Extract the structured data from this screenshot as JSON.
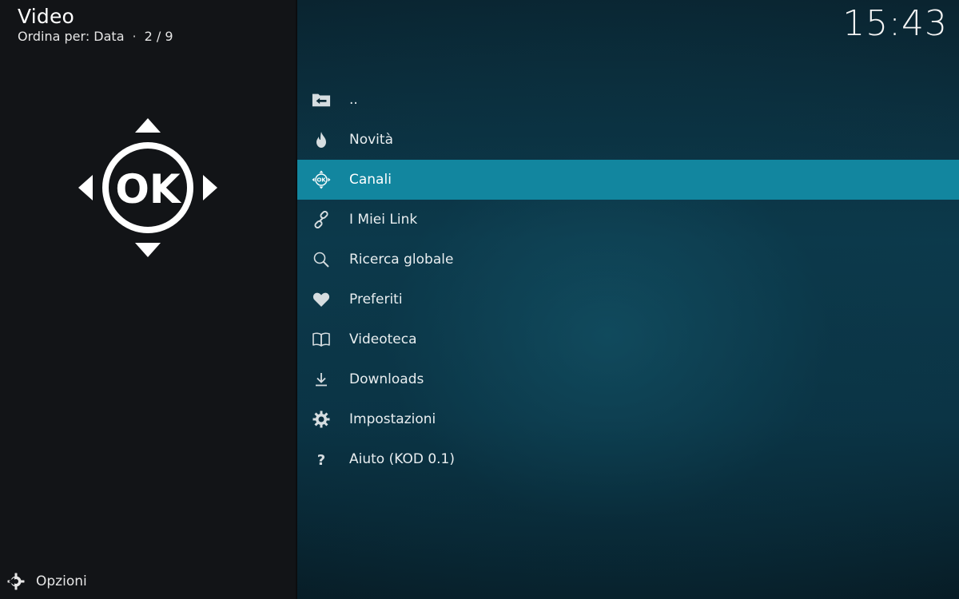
{
  "header": {
    "title": "Video",
    "sort_label": "Ordina per: Data",
    "separator": "·",
    "position": "2 / 9",
    "clock": "15:43"
  },
  "preview": {
    "icon": "dpad-ok-icon",
    "ok_text": "OK"
  },
  "menu": {
    "items": [
      {
        "label": "..",
        "icon": "folder-back-icon"
      },
      {
        "label": "Novità",
        "icon": "flame-icon"
      },
      {
        "label": "Canali",
        "icon": "dpad-ok-icon",
        "focused": true
      },
      {
        "label": "I Miei Link",
        "icon": "link-icon"
      },
      {
        "label": "Ricerca globale",
        "icon": "search-icon"
      },
      {
        "label": "Preferiti",
        "icon": "heart-icon"
      },
      {
        "label": "Videoteca",
        "icon": "book-icon"
      },
      {
        "label": "Downloads",
        "icon": "download-icon"
      },
      {
        "label": "Impostazioni",
        "icon": "gear-icon"
      },
      {
        "label": "Aiuto (KOD 0.1)",
        "icon": "question-icon"
      }
    ]
  },
  "footer": {
    "options_label": "Opzioni",
    "options_icon": "options-icon"
  },
  "colors": {
    "focus": "#12869f",
    "left_panel": "#121417",
    "text": "#e9eef0"
  }
}
